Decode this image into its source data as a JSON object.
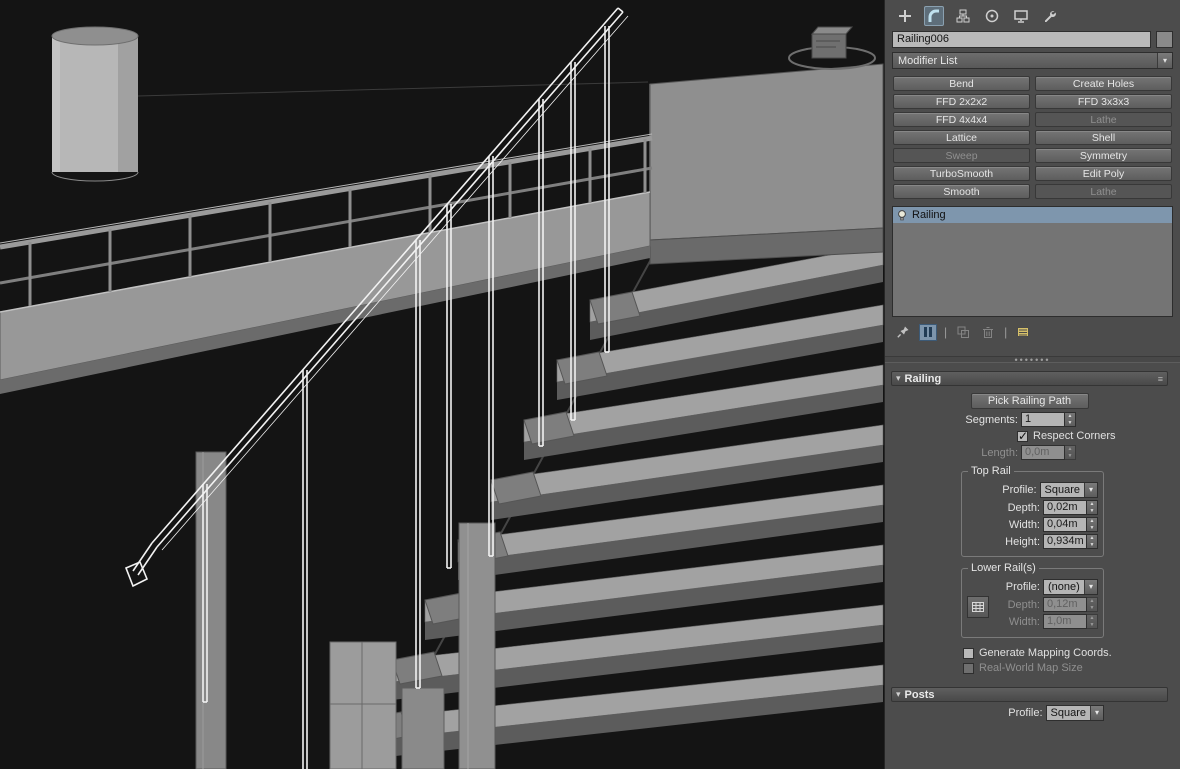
{
  "colors": {
    "selection_blue": "#7e96ad",
    "wireframe_white": "#f2f2f2",
    "panel_bg": "#4c4c4c"
  },
  "command_panel": {
    "tabs": [
      "create-icon",
      "modify-icon",
      "hierarchy-icon",
      "motion-icon",
      "display-icon",
      "utilities-icon"
    ],
    "object_name": "Railing006",
    "modifier_list_label": "Modifier List",
    "modifier_buttons": [
      {
        "label": "Bend",
        "enabled": true
      },
      {
        "label": "Create Holes",
        "enabled": true
      },
      {
        "label": "FFD 2x2x2",
        "enabled": true
      },
      {
        "label": "FFD 3x3x3",
        "enabled": true
      },
      {
        "label": "FFD 4x4x4",
        "enabled": true
      },
      {
        "label": "Lathe",
        "enabled": false
      },
      {
        "label": "Lattice",
        "enabled": true
      },
      {
        "label": "Shell",
        "enabled": true
      },
      {
        "label": "Sweep",
        "enabled": false
      },
      {
        "label": "Symmetry",
        "enabled": true
      },
      {
        "label": "TurboSmooth",
        "enabled": true
      },
      {
        "label": "Edit Poly",
        "enabled": true
      },
      {
        "label": "Smooth",
        "enabled": true
      },
      {
        "label": "Lathe",
        "enabled": false
      }
    ],
    "modifier_stack": {
      "items": [
        {
          "label": "Railing",
          "selected": true
        }
      ]
    },
    "stack_toolbar": [
      "pin-stack-icon",
      "show-end-result-icon",
      "make-unique-icon",
      "remove-modifier-icon",
      "configure-modifier-sets-icon"
    ],
    "railing_rollout": {
      "title": "Railing",
      "pick_railing_path": "Pick Railing Path",
      "segments": {
        "label": "Segments:",
        "value": "1",
        "enabled": true
      },
      "respect_corners": {
        "label": "Respect Corners",
        "checked": true
      },
      "length": {
        "label": "Length:",
        "value": "0,0m",
        "enabled": false
      },
      "top_rail": {
        "title": "Top Rail",
        "profile": {
          "label": "Profile:",
          "value": "Square"
        },
        "depth": {
          "label": "Depth:",
          "value": "0,02m",
          "enabled": true
        },
        "width": {
          "label": "Width:",
          "value": "0,04m",
          "enabled": true
        },
        "height": {
          "label": "Height:",
          "value": "0,934m",
          "enabled": true
        }
      },
      "lower_rail": {
        "title": "Lower Rail(s)",
        "profile": {
          "label": "Profile:",
          "value": "(none)"
        },
        "depth": {
          "label": "Depth:",
          "value": "0,12m",
          "enabled": false
        },
        "width": {
          "label": "Width:",
          "value": "1,0m",
          "enabled": false
        }
      },
      "generate_mapping": {
        "label": "Generate Mapping Coords.",
        "checked": false
      },
      "real_world": {
        "label": "Real-World Map Size",
        "checked": false,
        "enabled": false
      }
    },
    "posts_rollout": {
      "title": "Posts",
      "profile": {
        "label": "Profile:",
        "value": "Square"
      }
    }
  }
}
